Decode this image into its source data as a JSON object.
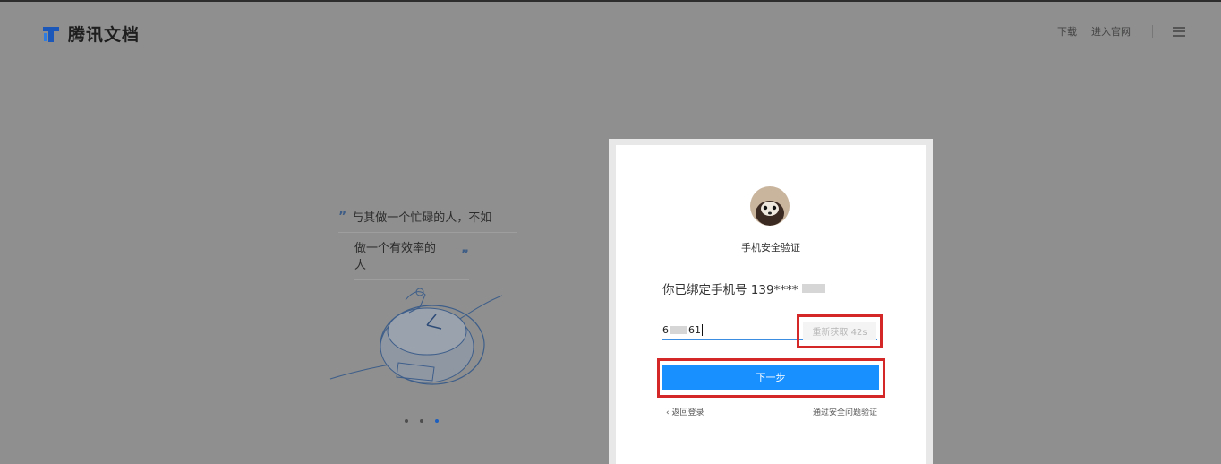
{
  "header": {
    "logo_text": "腾讯文档",
    "nav": {
      "download": "下载",
      "official": "进入官网"
    },
    "icons": {
      "logo": "tencent-docs-logo-icon",
      "menu": "hamburger-menu-icon"
    }
  },
  "left": {
    "quote_line1": "与其做一个忙碌的人，不如",
    "quote_line2": "做一个有效率的人",
    "quote_open": "”",
    "quote_close": "”"
  },
  "dialog": {
    "title": "手机安全验证",
    "phone_text": "你已绑定手机号 139****",
    "code_prefix": "6",
    "code_suffix": "61",
    "resend_label": "重新获取 42s",
    "next_label": "下一步",
    "back_label": "返回登录",
    "back_icon": "chevron-left-icon",
    "alt_label": "通过安全问题验证"
  },
  "colors": {
    "accent": "#1890ff",
    "highlight_border": "#d42828",
    "overlay": "#8e8f8e"
  }
}
